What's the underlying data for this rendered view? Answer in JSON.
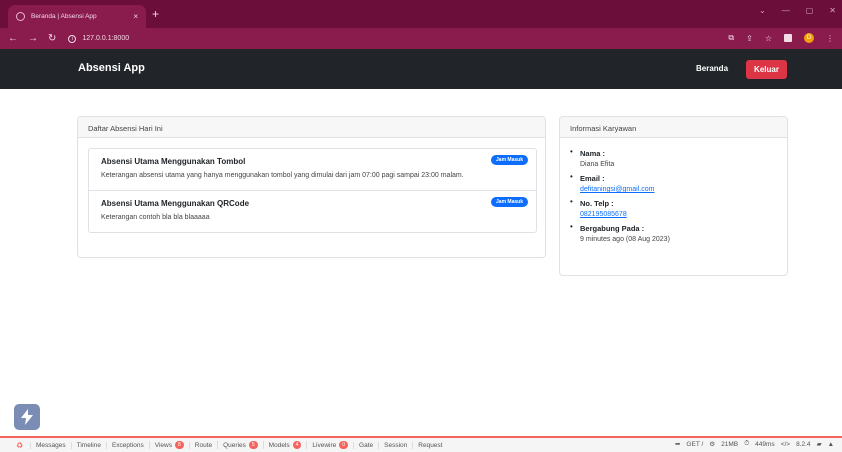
{
  "browser": {
    "tab_title": "Beranda | Absensi App",
    "tab_close": "×",
    "new_tab": "+",
    "url": "127.0.0.1:8000",
    "win_min": "—",
    "win_max": "▢",
    "win_close": "✕",
    "profile_initial": "D"
  },
  "navbar": {
    "brand": "Absensi App",
    "home_link": "Beranda",
    "logout_button": "Keluar"
  },
  "attendance": {
    "header": "Daftar Absensi Hari Ini",
    "items": [
      {
        "title": "Absensi Utama Menggunakan Tombol",
        "description": "Keterangan absensi utama yang hanya menggunakan tombol yang dimulai dari jam 07:00 pagi sampai 23:00 malam.",
        "badge": "Jam Masuk"
      },
      {
        "title": "Absensi Utama Menggunakan QRCode",
        "description": "Keterangan contoh bla bla blaaaaa",
        "badge": "Jam Masuk"
      }
    ]
  },
  "employee": {
    "header": "Informasi Karyawan",
    "name_label": "Nama :",
    "name_value": "Diana Efita",
    "email_label": "Email :",
    "email_value": "defitaningsi@gmail.com",
    "phone_label": "No. Telp :",
    "phone_value": "082195085678",
    "joined_label": "Bergabung Pada :",
    "joined_value": "9 minutes ago (08 Aug 2023)"
  },
  "debugbar": {
    "tabs": [
      {
        "label": "Messages",
        "count": ""
      },
      {
        "label": "Timeline",
        "count": ""
      },
      {
        "label": "Exceptions",
        "count": ""
      },
      {
        "label": "Views",
        "count": "8"
      },
      {
        "label": "Route",
        "count": ""
      },
      {
        "label": "Queries",
        "count": "5"
      },
      {
        "label": "Models",
        "count": "4"
      },
      {
        "label": "Livewire",
        "count": "0"
      },
      {
        "label": "Gate",
        "count": ""
      },
      {
        "label": "Session",
        "count": ""
      },
      {
        "label": "Request",
        "count": ""
      }
    ],
    "method": "GET /",
    "memory": "21MB",
    "time": "449ms",
    "php_version": "8.2.4"
  },
  "colors": {
    "browser_chrome": "#8a1b4d",
    "navbar_bg": "#212529",
    "logout_red": "#dc3545",
    "badge_blue": "#0d6efd"
  }
}
